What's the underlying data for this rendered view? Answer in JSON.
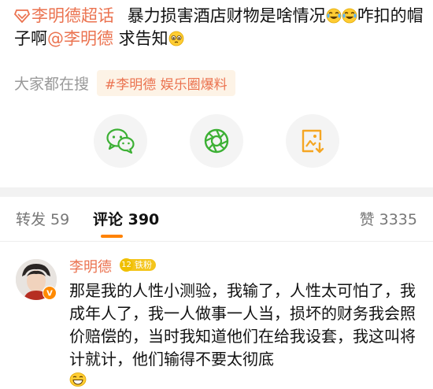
{
  "post": {
    "topic": "李明德超话",
    "text_part1": "暴力损害酒店财物是啥情况",
    "text_part2": "咋扣的帽子啊",
    "mention": "@李明德",
    "text_part3": " 求告知",
    "emojis": [
      "laugh-cry-emoji",
      "laugh-cry-emoji",
      "pleading-emoji"
    ]
  },
  "hot_search": {
    "label": "大家都在搜",
    "tag": "#李明德 娱乐圈爆料"
  },
  "share": {
    "icons": [
      "wechat-icon",
      "moments-icon",
      "save-image-icon"
    ],
    "colors": {
      "wechat": "#3cb034",
      "moments": "#3cb034",
      "save": "#f5a623"
    }
  },
  "tabs": {
    "repost": "转发 59",
    "comments": "评论 390",
    "likes": "赞 3335"
  },
  "comment": {
    "author": "李明德",
    "level": "12",
    "level_label": "铁粉",
    "text": "那是我的人性小测验，我输了，人性太可怕了，我成年人了，我一人做事一人当，损坏的财务我会照价赔偿的，当时我知道他们在给我设套，我这叫将计就计，他们输得不要太彻底"
  },
  "colors": {
    "accent": "#eb7350",
    "tab_indicator": "#ff8200",
    "tag_bg": "#fdf3e6"
  }
}
